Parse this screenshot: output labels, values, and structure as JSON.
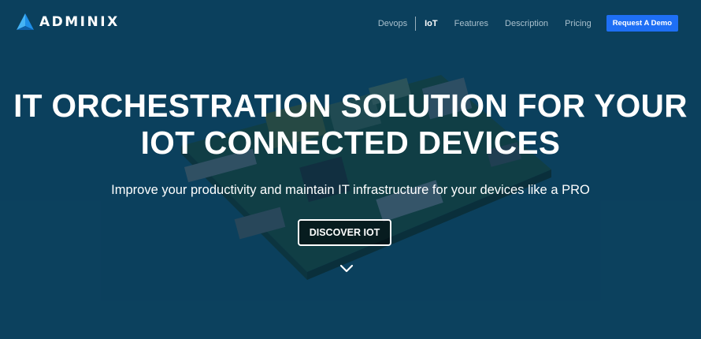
{
  "brand": {
    "name": "ADMINIX",
    "logo_icon": "triangle-logo-icon"
  },
  "nav": {
    "links": [
      {
        "label": "Devops",
        "active": false
      },
      {
        "label": "IoT",
        "active": true
      },
      {
        "label": "Features",
        "active": false
      },
      {
        "label": "Description",
        "active": false
      },
      {
        "label": "Pricing",
        "active": false
      }
    ],
    "cta_label": "Request A Demo"
  },
  "hero": {
    "headline_line1": "IT ORCHESTRATION SOLUTION FOR YOUR",
    "headline_line2": "IOT CONNECTED DEVICES",
    "subtitle": "Improve your productivity and maintain IT infrastructure for your devices like a PRO",
    "button_label": "DISCOVER IOT",
    "scroll_icon": "chevron-down-icon"
  },
  "colors": {
    "background": "#0f4663",
    "accent": "#1e6ff5",
    "nav_text": "#a9c0cd",
    "text": "#ffffff"
  }
}
